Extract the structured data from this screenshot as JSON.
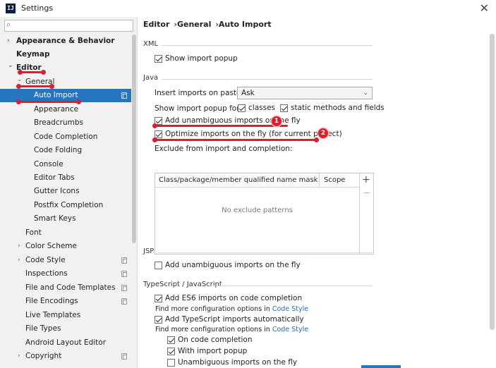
{
  "window": {
    "logo_text": "IJ",
    "title": "Settings",
    "close_glyph": "✕"
  },
  "search": {
    "placeholder": "",
    "value": ""
  },
  "sidebar": {
    "items": [
      {
        "label": "Appearance & Behavior",
        "arrow": "›",
        "bold": true
      },
      {
        "label": "Keymap",
        "arrow": "",
        "bold": true
      },
      {
        "label": "Editor",
        "arrow": "⌄",
        "bold": true
      },
      {
        "label": "General",
        "arrow": "⌄",
        "bold": false
      },
      {
        "label": "Auto Import",
        "selected": true
      },
      {
        "label": "Appearance"
      },
      {
        "label": "Breadcrumbs"
      },
      {
        "label": "Code Completion"
      },
      {
        "label": "Code Folding"
      },
      {
        "label": "Console"
      },
      {
        "label": "Editor Tabs"
      },
      {
        "label": "Gutter Icons"
      },
      {
        "label": "Postfix Completion"
      },
      {
        "label": "Smart Keys"
      },
      {
        "label": "Font"
      },
      {
        "label": "Color Scheme",
        "arrow": "›"
      },
      {
        "label": "Code Style",
        "arrow": "›"
      },
      {
        "label": "Inspections"
      },
      {
        "label": "File and Code Templates"
      },
      {
        "label": "File Encodings"
      },
      {
        "label": "Live Templates"
      },
      {
        "label": "File Types"
      },
      {
        "label": "Android Layout Editor"
      },
      {
        "label": "Copyright",
        "arrow": "›"
      }
    ]
  },
  "breadcrumb": {
    "parts": [
      "Editor",
      "General",
      "Auto Import"
    ],
    "separator": "›"
  },
  "xml": {
    "section": "XML",
    "show_import_popup": {
      "label": "Show import popup",
      "checked": true
    }
  },
  "java": {
    "section": "Java",
    "insert_on_paste_label": "Insert imports on paste:",
    "insert_on_paste_value": "Ask",
    "show_popup_for_label": "Show import popup for:",
    "classes": {
      "label": "classes",
      "checked": true
    },
    "static_methods": {
      "label": "static methods and fields",
      "checked": true
    },
    "add_unambiguous": {
      "label": "Add unambiguous imports on the fly",
      "checked": true
    },
    "optimize_imports": {
      "label": "Optimize imports on the fly (for current project)",
      "checked": true
    },
    "exclude_label": "Exclude from import and completion:",
    "table": {
      "col1": "Class/package/member qualified name mask",
      "col2": "Scope",
      "empty": "No exclude patterns",
      "add_glyph": "+",
      "remove_glyph": "−"
    }
  },
  "jsp": {
    "section": "JSP",
    "add_unambiguous": {
      "label": "Add unambiguous imports on the fly",
      "checked": false
    }
  },
  "typescript": {
    "section": "TypeScript / JavaScript",
    "add_es6": {
      "label": "Add ES6 imports on code completion",
      "checked": true
    },
    "more_config_1": "Find more configuration options in",
    "code_style_link_1": "Code Style",
    "add_ts_auto": {
      "label": "Add TypeScript imports automatically",
      "checked": true
    },
    "more_config_2": "Find more configuration options in",
    "code_style_link_2": "Code Style",
    "on_code_completion": {
      "label": "On code completion",
      "checked": true
    },
    "with_import_popup": {
      "label": "With import popup",
      "checked": true
    },
    "partial_option": {
      "label": "Unambiguous imports on the fly",
      "checked": false
    }
  },
  "annotations": {
    "badge_1": "1",
    "badge_2": "2",
    "highlight_color": "#d9202e"
  },
  "colors": {
    "selection": "#2675bf",
    "link": "#2a66c1"
  }
}
